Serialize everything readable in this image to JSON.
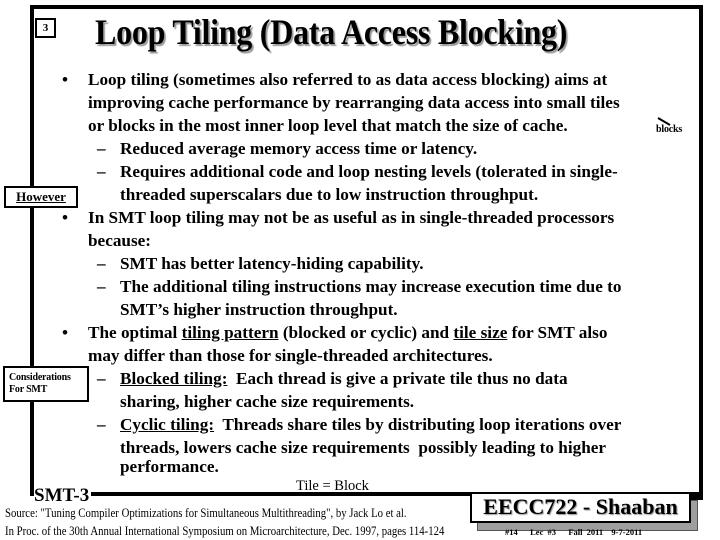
{
  "slide": {
    "slide_number_box": "3",
    "title": "Loop Tiling (Data Access Blocking)",
    "section_label": "SMT-3",
    "side_labels": {
      "however": "However",
      "considerations_line1": "Considerations",
      "considerations_line2": "For SMT"
    },
    "margin_note": "blocks",
    "caption": "Tile = Block",
    "bullets": [
      {
        "lines": [
          "Loop tiling (sometimes also referred to as data access blocking) aims at",
          "improving cache performance by rearranging data access into small tiles",
          "or blocks in the most inner loop level that match the size of cache."
        ],
        "subs": [
          {
            "lines": [
              "Reduced average memory access time or latency."
            ]
          },
          {
            "lines": [
              "Requires additional code and loop nesting levels (tolerated in single-",
              "threaded superscalars due to low instruction throughput."
            ]
          }
        ]
      },
      {
        "lines": [
          "In SMT loop tiling may not be as useful as in single-threaded processors",
          "because:"
        ],
        "subs": [
          {
            "lines": [
              "SMT has better latency-hiding capability."
            ]
          },
          {
            "lines": [
              "The additional tiling instructions may increase execution time due to",
              "SMT’s higher instruction throughput."
            ]
          }
        ]
      },
      {
        "line1_pre": "The optimal ",
        "line1_u1": "tiling pattern",
        "line1_mid": " (blocked or cyclic) and ",
        "line1_u2": "tile size",
        "line1_post": " for SMT also",
        "line2": "may differ than those for single-threaded architectures.",
        "subs": [
          {
            "term": "Blocked tiling:",
            "line1_rest": "  Each thread is give a private tile thus no data",
            "line2": "sharing, higher cache size requirements."
          },
          {
            "term": "Cyclic tiling:",
            "line1_rest": "  Threads share tiles by distributing loop iterations over",
            "line2": "threads, lowers cache size requirements  possibly leading to higher",
            "line3": "performance."
          }
        ]
      }
    ],
    "bullet_glyph": "•",
    "dash_glyph": "–"
  },
  "footer": {
    "source_line1": "Source:  \"Tuning Compiler Optimizations for Simultaneous Multithreading\", by Jack Lo et al.",
    "source_line2": "In Proc. of the 30th Annual International Symposium on Microarchitecture, Dec. 1997, pages 114-124",
    "course_badge": "EECC722 - Shaaban",
    "meta": "#14   Lec #3   Fall 2011  9-7-2011"
  }
}
